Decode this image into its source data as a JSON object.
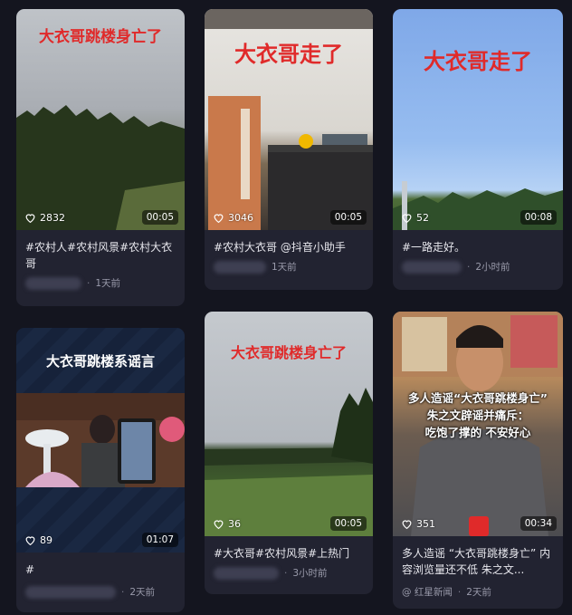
{
  "cards": [
    {
      "overlay": "大衣哥跳楼身亡了",
      "likes": "2832",
      "duration": "00:05",
      "caption": "#农村人#农村风景#农村大衣哥",
      "time": "1天前"
    },
    {
      "overlay": "大衣哥走了",
      "likes": "3046",
      "duration": "00:05",
      "caption": "#农村大衣哥 @抖音小助手",
      "time": "1天前"
    },
    {
      "overlay": "大衣哥走了",
      "likes": "52",
      "duration": "00:08",
      "caption": "#一路走好。",
      "time": "2小时前"
    },
    {
      "overlay": "大衣哥跳楼系谣言",
      "likes": "89",
      "duration": "01:07",
      "caption": "#",
      "time": "2天前"
    },
    {
      "overlay": "大衣哥跳楼身亡了",
      "likes": "36",
      "duration": "00:05",
      "caption": "#大衣哥#农村风景#上热门",
      "time": "3小时前"
    },
    {
      "overlay_lines": [
        "多人造谣“大衣哥跳楼身亡”",
        "朱之文辟谣并痛斥：",
        "吃饱了撑的 不安好心"
      ],
      "likes": "351",
      "duration": "00:34",
      "caption": "多人造谣 “大衣哥跳楼身亡” 内容浏览量还不低 朱之文...",
      "author": "@ 红星新闻",
      "time": "2天前"
    }
  ],
  "colors": {
    "background": "#14151f",
    "card": "#222331",
    "overlay_red": "#e02a2a"
  },
  "icons": {
    "like": "heart-outline-icon"
  }
}
